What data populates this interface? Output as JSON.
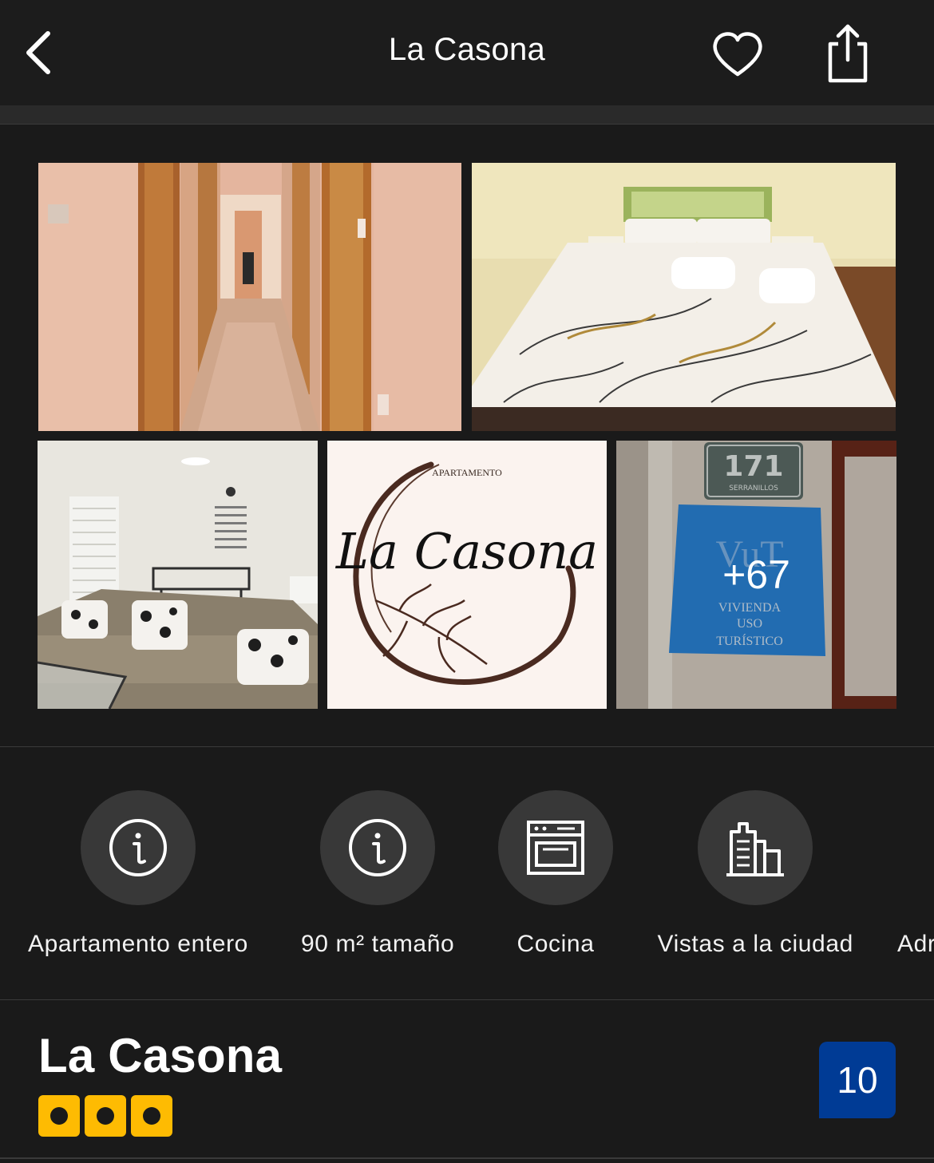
{
  "header": {
    "title": "La Casona",
    "back_icon": "chevron-left-icon",
    "favorite_icon": "heart-outline-icon",
    "share_icon": "share-icon"
  },
  "gallery": {
    "photos": [
      {
        "name": "hallway-photo"
      },
      {
        "name": "bedroom-photo"
      },
      {
        "name": "living-room-photo"
      },
      {
        "name": "logo-photo",
        "logo_text_small": "APARTAMENTO",
        "logo_text": "La Casona"
      },
      {
        "name": "sign-photo",
        "sign_number": "171",
        "sign_street": "SERRANILLOS",
        "plaque_code": "VuT",
        "plaque_lines": [
          "VIVIENDA",
          "USO",
          "TURÍSTICO"
        ]
      }
    ],
    "more_count": "+67"
  },
  "facilities": [
    {
      "icon": "info-icon",
      "label": "Apartamento entero"
    },
    {
      "icon": "info-icon",
      "label": "90 m² tamaño"
    },
    {
      "icon": "oven-icon",
      "label": "Cocina"
    },
    {
      "icon": "city-buildings-icon",
      "label": "Vistas a la ciudad"
    },
    {
      "icon": "",
      "label": "Adr"
    }
  ],
  "property": {
    "name": "La Casona",
    "rating_dots": 3,
    "rating_color": "#febb02",
    "score": "10",
    "score_color": "#003b95"
  }
}
